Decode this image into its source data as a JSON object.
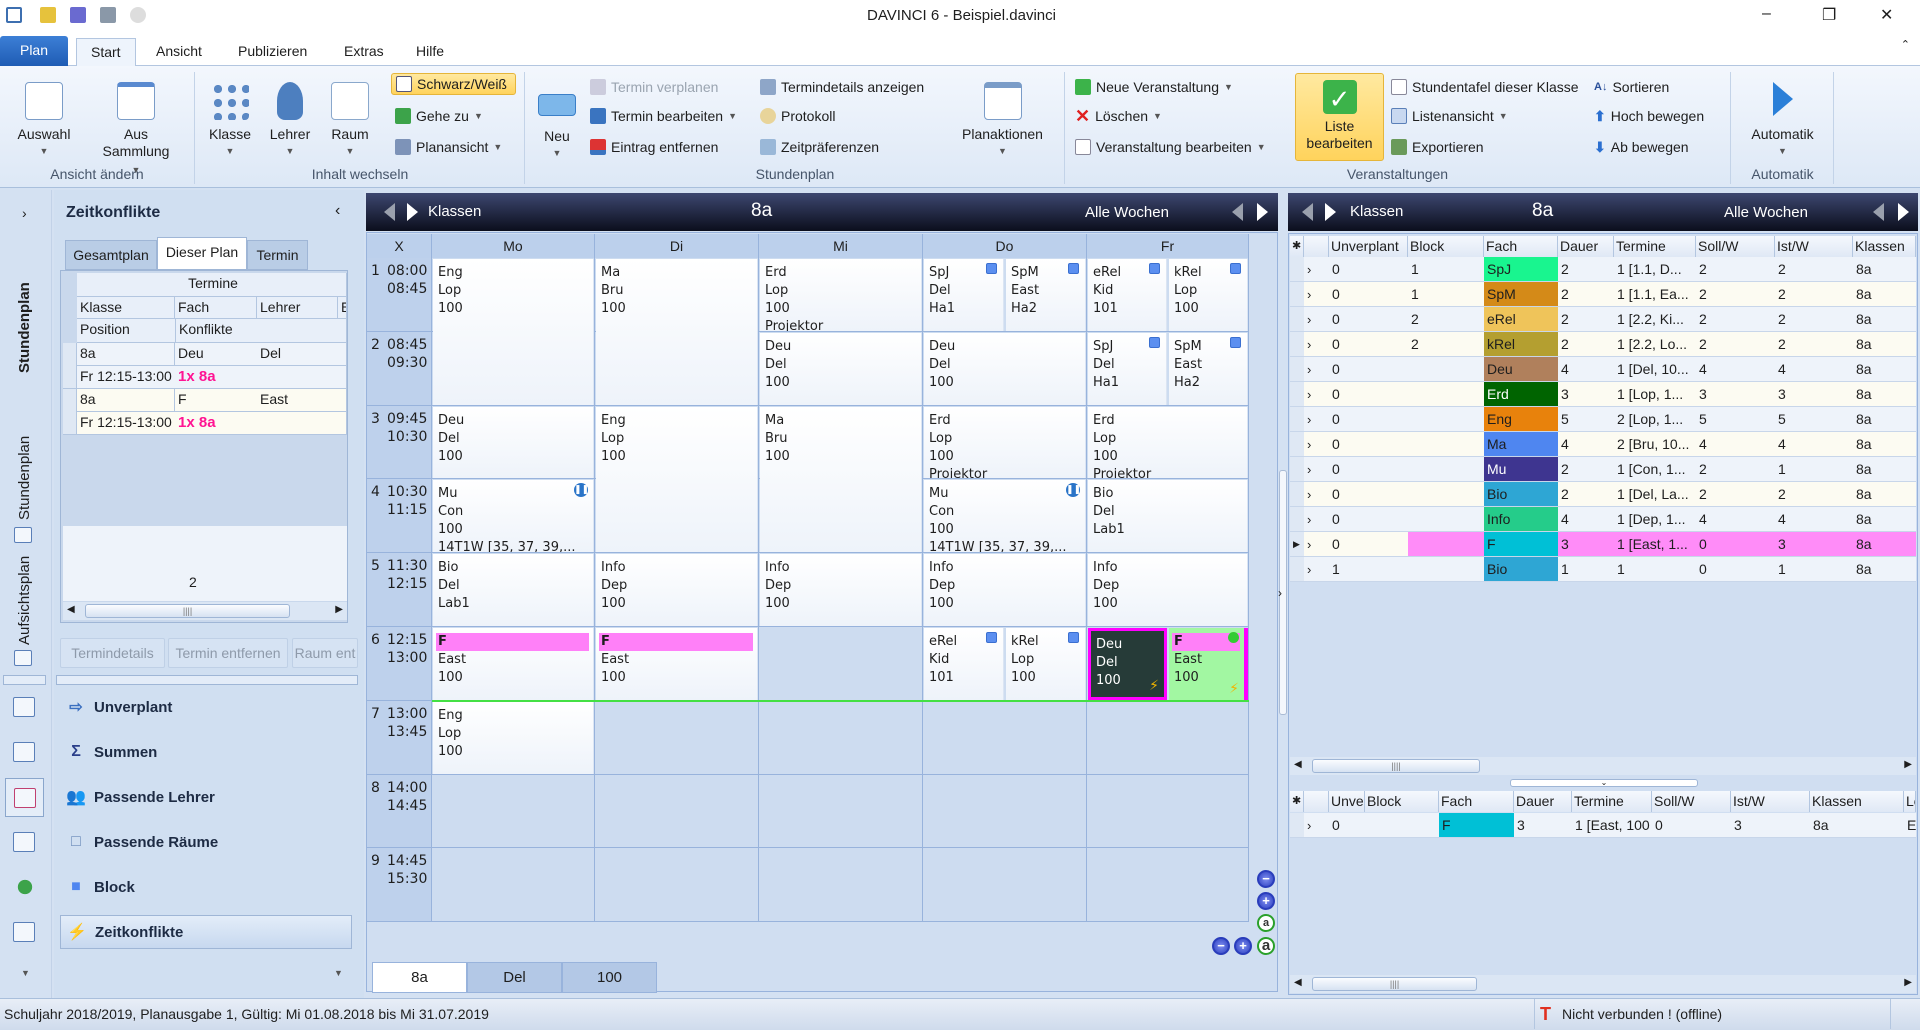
{
  "window": {
    "title": "DAVINCI 6 - Beispiel.davinci",
    "minimize": "–",
    "restore": "❐",
    "close": "✕"
  },
  "ribbon": {
    "plan_button": "Plan",
    "tabs": [
      "Start",
      "Ansicht",
      "Publizieren",
      "Extras",
      "Hilfe"
    ],
    "active_tab": "Start",
    "groups": {
      "ansicht": {
        "label": "Ansicht ändern",
        "auswahl": "Auswahl",
        "aus_sammlung_1": "Aus",
        "aus_sammlung_2": "Sammlung"
      },
      "inhalt": {
        "label": "Inhalt wechseln",
        "klasse": "Klasse",
        "lehrer": "Lehrer",
        "raum": "Raum",
        "schwarz_weiss": "Schwarz/Weiß",
        "gehe_zu": "Gehe zu",
        "planansicht": "Planansicht"
      },
      "stundenplan": {
        "label": "Stundenplan",
        "neu": "Neu",
        "termin_verplanen": "Termin verplanen",
        "termin_bearbeiten": "Termin bearbeiten",
        "eintrag_entfernen": "Eintrag entfernen",
        "termindetails": "Termindetails anzeigen",
        "protokoll": "Protokoll",
        "zeitpraeferenzen": "Zeitpräferenzen",
        "planaktionen": "Planaktionen"
      },
      "veranstaltungen": {
        "label": "Veranstaltungen",
        "neue": "Neue Veranstaltung",
        "loeschen": "Löschen",
        "bearbeiten": "Veranstaltung bearbeiten",
        "liste_1": "Liste",
        "liste_2": "bearbeiten",
        "stundentafel": "Stundentafel dieser Klasse",
        "listenansicht": "Listenansicht",
        "exportieren": "Exportieren",
        "sortieren": "Sortieren",
        "hoch": "Hoch bewegen",
        "ab": "Ab bewegen"
      },
      "automatik": {
        "label": "Automatik",
        "button": "Automatik"
      }
    }
  },
  "left_strip": {
    "tabs": [
      "Stundenplan",
      "Stundenplan",
      "Aufsichtsplan"
    ]
  },
  "left_panel": {
    "title": "Zeitkonflikte",
    "tabs": [
      "Gesamtplan",
      "Dieser Plan",
      "Termin"
    ],
    "active_tab": "Dieser Plan",
    "grid": {
      "band": "Termine",
      "headers": [
        "Klasse",
        "Fach",
        "Lehrer",
        "E"
      ],
      "headers2": [
        "Position",
        "Konflikte"
      ],
      "rows": [
        {
          "klasse": "8a",
          "fach": "Deu",
          "lehrer": "Del",
          "position": "Fr 12:15-13:00",
          "konflikte": "1x 8a"
        },
        {
          "klasse": "8a",
          "fach": "F",
          "lehrer": "East",
          "position": "Fr 12:15-13:00",
          "konflikte": "1x 8a"
        }
      ],
      "footer_count": "2"
    },
    "buttons": [
      "Termindetails",
      "Termin entfernen",
      "Raum ent"
    ],
    "nav": [
      {
        "label": "Unverplant",
        "icon": "unplanned-icon"
      },
      {
        "label": "Summen",
        "icon": "sigma-icon"
      },
      {
        "label": "Passende Lehrer",
        "icon": "teachers-icon"
      },
      {
        "label": "Passende Räume",
        "icon": "room-cube-icon"
      },
      {
        "label": "Block",
        "icon": "block-icon"
      },
      {
        "label": "Zeitkonflikte",
        "icon": "lightning-icon"
      }
    ],
    "active_nav": "Zeitkonflikte"
  },
  "timetable": {
    "header": {
      "label": "Klassen",
      "entity": "8a",
      "weeks": "Alle Wochen"
    },
    "corner": "X",
    "days": [
      "Mo",
      "Di",
      "Mi",
      "Do",
      "Fr"
    ],
    "periods": [
      {
        "n": "1",
        "start": "08:00",
        "end": "08:45"
      },
      {
        "n": "2",
        "start": "08:45",
        "end": "09:30"
      },
      {
        "n": "3",
        "start": "09:45",
        "end": "10:30"
      },
      {
        "n": "4",
        "start": "10:30",
        "end": "11:15"
      },
      {
        "n": "5",
        "start": "11:30",
        "end": "12:15"
      },
      {
        "n": "6",
        "start": "12:15",
        "end": "13:00"
      },
      {
        "n": "7",
        "start": "13:00",
        "end": "13:45"
      },
      {
        "n": "8",
        "start": "14:00",
        "end": "14:45"
      },
      {
        "n": "9",
        "start": "14:45",
        "end": "15:30"
      }
    ],
    "lessons": [
      {
        "day": 0,
        "period": 1,
        "span": 2,
        "lines": [
          "Eng",
          "Lop",
          "100"
        ]
      },
      {
        "day": 0,
        "period": 3,
        "span": 1,
        "lines": [
          "Deu",
          "Del",
          "100"
        ]
      },
      {
        "day": 0,
        "period": 4,
        "span": 1,
        "lines": [
          "Mu",
          "Con",
          "100",
          "14T1W [35, 37, 39,..."
        ],
        "info": true
      },
      {
        "day": 0,
        "period": 5,
        "span": 1,
        "lines": [
          "Bio",
          "Del",
          "Lab1"
        ]
      },
      {
        "day": 0,
        "period": 6,
        "span": 1,
        "lines": [
          "F",
          "East",
          "100"
        ],
        "pink_header": true
      },
      {
        "day": 0,
        "period": 7,
        "span": 1,
        "lines": [
          "Eng",
          "Lop",
          "100"
        ]
      },
      {
        "day": 1,
        "period": 1,
        "span": 2,
        "lines": [
          "Ma",
          "Bru",
          "100"
        ]
      },
      {
        "day": 1,
        "period": 3,
        "span": 2,
        "lines": [
          "Eng",
          "Lop",
          "100"
        ]
      },
      {
        "day": 1,
        "period": 5,
        "span": 1,
        "lines": [
          "Info",
          "Dep",
          "100"
        ]
      },
      {
        "day": 1,
        "period": 6,
        "span": 1,
        "lines": [
          "F",
          "East",
          "100"
        ],
        "pink_header": true
      },
      {
        "day": 2,
        "period": 1,
        "span": 1,
        "lines": [
          "Erd",
          "Lop",
          "100",
          "Projektor"
        ]
      },
      {
        "day": 2,
        "period": 2,
        "span": 1,
        "lines": [
          "Deu",
          "Del",
          "100"
        ]
      },
      {
        "day": 2,
        "period": 3,
        "span": 2,
        "lines": [
          "Ma",
          "Bru",
          "100"
        ]
      },
      {
        "day": 2,
        "period": 5,
        "span": 1,
        "lines": [
          "Info",
          "Dep",
          "100"
        ]
      },
      {
        "day": 3,
        "period": 1,
        "span": 1,
        "half": "left",
        "lines": [
          "SpJ",
          "Del",
          "Ha1"
        ],
        "block": true
      },
      {
        "day": 3,
        "period": 1,
        "span": 1,
        "half": "right",
        "lines": [
          "SpM",
          "East",
          "Ha2"
        ],
        "block": true
      },
      {
        "day": 3,
        "period": 2,
        "span": 1,
        "lines": [
          "Deu",
          "Del",
          "100"
        ]
      },
      {
        "day": 3,
        "period": 3,
        "span": 1,
        "lines": [
          "Erd",
          "Lop",
          "100",
          "Projektor"
        ]
      },
      {
        "day": 3,
        "period": 4,
        "span": 1,
        "lines": [
          "Mu",
          "Con",
          "100",
          "14T1W [35, 37, 39,..."
        ],
        "info": true
      },
      {
        "day": 3,
        "period": 5,
        "span": 1,
        "lines": [
          "Info",
          "Dep",
          "100"
        ]
      },
      {
        "day": 3,
        "period": 6,
        "span": 1,
        "half": "left",
        "lines": [
          "eRel",
          "Kid",
          "101"
        ],
        "block": true
      },
      {
        "day": 3,
        "period": 6,
        "span": 1,
        "half": "right",
        "lines": [
          "kRel",
          "Lop",
          "100"
        ],
        "block": true
      },
      {
        "day": 4,
        "period": 1,
        "span": 1,
        "half": "left",
        "lines": [
          "eRel",
          "Kid",
          "101"
        ],
        "block": true
      },
      {
        "day": 4,
        "period": 1,
        "span": 1,
        "half": "right",
        "lines": [
          "kRel",
          "Lop",
          "100"
        ],
        "block": true
      },
      {
        "day": 4,
        "period": 2,
        "span": 1,
        "half": "left",
        "lines": [
          "SpJ",
          "Del",
          "Ha1"
        ],
        "block": true
      },
      {
        "day": 4,
        "period": 2,
        "span": 1,
        "half": "right",
        "lines": [
          "SpM",
          "East",
          "Ha2"
        ],
        "block": true
      },
      {
        "day": 4,
        "period": 3,
        "span": 1,
        "lines": [
          "Erd",
          "Lop",
          "100",
          "Projektor"
        ]
      },
      {
        "day": 4,
        "period": 4,
        "span": 1,
        "lines": [
          "Bio",
          "Del",
          "Lab1"
        ]
      },
      {
        "day": 4,
        "period": 5,
        "span": 1,
        "lines": [
          "Info",
          "Dep",
          "100"
        ]
      },
      {
        "day": 4,
        "period": 6,
        "span": 1,
        "half": "left",
        "lines": [
          "Deu",
          "Del",
          "100"
        ],
        "state": "selected",
        "conflict": true
      },
      {
        "day": 4,
        "period": 6,
        "span": 1,
        "half": "right",
        "lines": [
          "F",
          "East",
          "100"
        ],
        "state": "conflict",
        "pink_header": true,
        "conflict": true,
        "dot": true
      }
    ],
    "zoom_buttons": [
      "−",
      "+",
      "a",
      "a"
    ],
    "bottom_tabs": [
      "8a",
      "Del",
      "100"
    ],
    "active_bottom_tab": "8a"
  },
  "veranstaltungen": {
    "header": {
      "label": "Klassen",
      "entity": "8a",
      "weeks": "Alle Wochen"
    },
    "columns": [
      "Unverplant",
      "Block",
      "Fach",
      "Dauer",
      "Termine",
      "Soll/W",
      "Ist/W",
      "Klassen"
    ],
    "rows": [
      {
        "unverplant": "0",
        "block": "1",
        "fach": "SpJ",
        "color": "#19f58f",
        "dauer": "2",
        "termine": "1 [1.1, D...",
        "soll": "2",
        "ist": "2",
        "klassen": "8a"
      },
      {
        "unverplant": "0",
        "block": "1",
        "fach": "SpM",
        "color": "#d48a18",
        "dauer": "2",
        "termine": "1 [1.1, Ea...",
        "soll": "2",
        "ist": "2",
        "klassen": "8a"
      },
      {
        "unverplant": "0",
        "block": "2",
        "fach": "eRel",
        "color": "#efc45a",
        "dauer": "2",
        "termine": "1 [2.2, Ki...",
        "soll": "2",
        "ist": "2",
        "klassen": "8a"
      },
      {
        "unverplant": "0",
        "block": "2",
        "fach": "kRel",
        "color": "#b49f30",
        "dauer": "2",
        "termine": "1 [2.2, Lo...",
        "soll": "2",
        "ist": "2",
        "klassen": "8a"
      },
      {
        "unverplant": "0",
        "block": "",
        "fach": "Deu",
        "color": "#b0805c",
        "dauer": "4",
        "termine": "1 [Del, 10...",
        "soll": "4",
        "ist": "4",
        "klassen": "8a"
      },
      {
        "unverplant": "0",
        "block": "",
        "fach": "Erd",
        "color": "#006400",
        "text": "#ffffff",
        "dauer": "3",
        "termine": "1 [Lop, 1...",
        "soll": "3",
        "ist": "3",
        "klassen": "8a"
      },
      {
        "unverplant": "0",
        "block": "",
        "fach": "Eng",
        "color": "#e8820c",
        "dauer": "5",
        "termine": "2 [Lop, 1...",
        "soll": "5",
        "ist": "5",
        "klassen": "8a"
      },
      {
        "unverplant": "0",
        "block": "",
        "fach": "Ma",
        "color": "#4f86f0",
        "dauer": "4",
        "termine": "2 [Bru, 10...",
        "soll": "4",
        "ist": "4",
        "klassen": "8a"
      },
      {
        "unverplant": "0",
        "block": "",
        "fach": "Mu",
        "color": "#3e3590",
        "text": "#ffffff",
        "dauer": "2",
        "termine": "1 [Con, 1...",
        "soll": "2",
        "ist": "1",
        "klassen": "8a"
      },
      {
        "unverplant": "0",
        "block": "",
        "fach": "Bio",
        "color": "#2ea6d4",
        "dauer": "2",
        "termine": "1 [Del, La...",
        "soll": "2",
        "ist": "2",
        "klassen": "8a"
      },
      {
        "unverplant": "0",
        "block": "",
        "fach": "Info",
        "color": "#25cc8a",
        "dauer": "4",
        "termine": "1 [Dep, 1...",
        "soll": "4",
        "ist": "4",
        "klassen": "8a"
      },
      {
        "unverplant": "0",
        "block": "",
        "fach": "F",
        "color": "#00c0d6",
        "dauer": "3",
        "termine": "1 [East, 1...",
        "soll": "0",
        "ist": "3",
        "klassen": "8a",
        "highlight": "#ff8cf8",
        "current": true
      },
      {
        "unverplant": "1",
        "block": "",
        "fach": "Bio",
        "color": "#2ea6d4",
        "dauer": "1",
        "termine": "1",
        "soll": "0",
        "ist": "1",
        "klassen": "8a"
      }
    ],
    "detail": {
      "columns": [
        "Unve",
        "Block",
        "Fach",
        "Dauer",
        "Termine",
        "Soll/W",
        "Ist/W",
        "Klassen",
        "Le"
      ],
      "row": {
        "unverplant": "0",
        "block": "",
        "fach": "F",
        "color": "#00c0d6",
        "dauer": "3",
        "termine": "1 [East, 100",
        "soll": "0",
        "ist": "3",
        "klassen": "8a",
        "le": "Ea"
      }
    }
  },
  "status": {
    "left": "Schuljahr 2018/2019, Planausgabe 1, Gültig: Mi 01.08.2018 bis Mi 31.07.2019",
    "connection": "Nicht verbunden ! (offline)"
  }
}
